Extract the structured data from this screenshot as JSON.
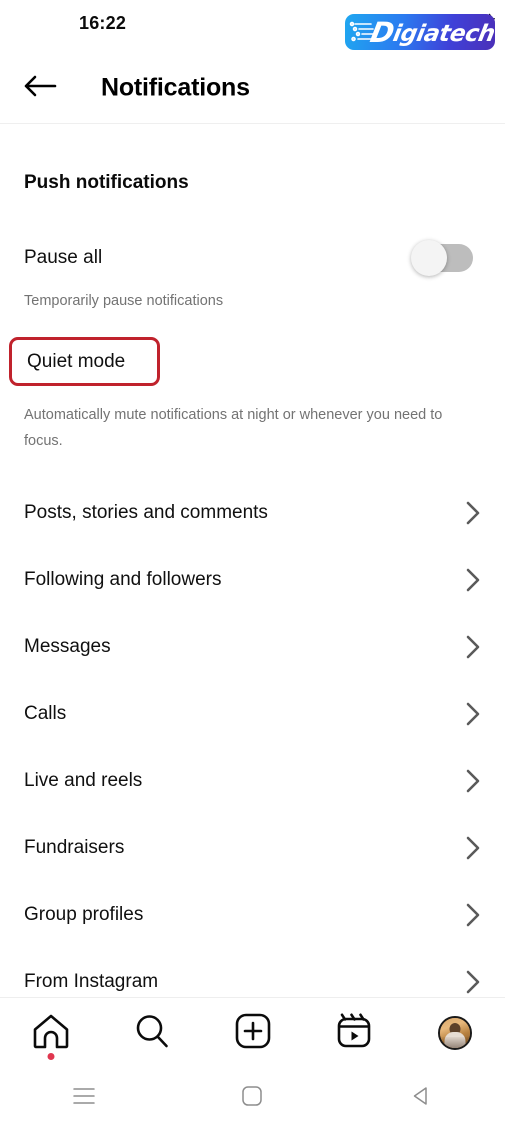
{
  "status_bar": {
    "time": "16:22",
    "icons": [
      "alarm-icon",
      "bluetooth-icon"
    ],
    "watermark": {
      "text_cap": "D",
      "text_rest": "igiatech",
      "gradient_start": "#1fa7f0",
      "gradient_end": "#4b2fb8"
    }
  },
  "header": {
    "back_label": "Back",
    "title": "Notifications"
  },
  "content": {
    "section_title": "Push notifications",
    "pause": {
      "label": "Pause all",
      "sub": "Temporarily pause notifications",
      "toggle_state": "off"
    },
    "quiet": {
      "label": "Quiet mode",
      "sub": "Automatically mute notifications at night or whenever you need to focus.",
      "highlight_color": "#c0222c"
    },
    "nav_items": [
      {
        "label": "Posts, stories and comments"
      },
      {
        "label": "Following and followers"
      },
      {
        "label": "Messages"
      },
      {
        "label": "Calls"
      },
      {
        "label": "Live and reels"
      },
      {
        "label": "Fundraisers"
      },
      {
        "label": "Group profiles"
      },
      {
        "label": "From Instagram"
      }
    ]
  },
  "tabbar": {
    "items": [
      {
        "name": "home-icon",
        "badge": true
      },
      {
        "name": "search-icon",
        "badge": false
      },
      {
        "name": "create-icon",
        "badge": false
      },
      {
        "name": "reels-icon",
        "badge": false
      },
      {
        "name": "profile-avatar",
        "badge": false
      }
    ],
    "badge_color": "#e0364f"
  },
  "system_nav": {
    "buttons": [
      "recents-icon",
      "home-square-icon",
      "back-triangle-icon"
    ]
  }
}
